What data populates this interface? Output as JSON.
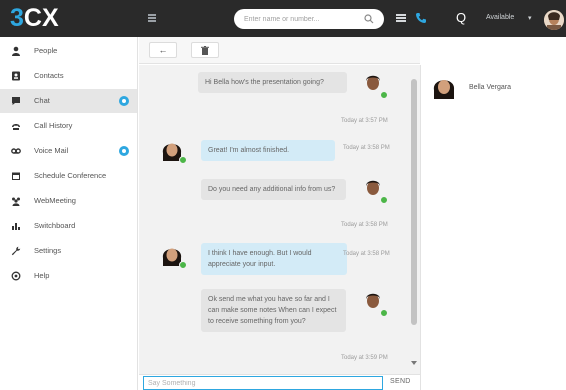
{
  "header": {
    "logo_prefix": "3",
    "logo_suffix": "CX",
    "search_placeholder": "Enter name or number...",
    "q_label": "Q",
    "status_label": "Available",
    "status_caret": "▾"
  },
  "sidebar": {
    "items": [
      {
        "label": "People",
        "icon": "person-icon",
        "active": false
      },
      {
        "label": "Contacts",
        "icon": "contacts-icon",
        "active": false
      },
      {
        "label": "Chat",
        "icon": "chat-icon",
        "active": true,
        "badge": true
      },
      {
        "label": "Call History",
        "icon": "call-history-icon",
        "active": false
      },
      {
        "label": "Voice Mail",
        "icon": "voicemail-icon",
        "active": false,
        "badge": true
      },
      {
        "label": "Schedule Conference",
        "icon": "calendar-icon",
        "active": false
      },
      {
        "label": "WebMeeting",
        "icon": "webmeeting-icon",
        "active": false
      },
      {
        "label": "Switchboard",
        "icon": "switchboard-icon",
        "active": false
      },
      {
        "label": "Settings",
        "icon": "wrench-icon",
        "active": false
      },
      {
        "label": "Help",
        "icon": "help-icon",
        "active": false
      }
    ]
  },
  "toolbar": {
    "back_label": "←",
    "delete_label": "🗑"
  },
  "chat": {
    "messages": [
      {
        "text": "Hi Bella how's the presentation going?",
        "direction": "out",
        "timestamp": "Today at 3:57 PM"
      },
      {
        "text": "Great! I'm almost finished.",
        "direction": "in",
        "timestamp": "Today at 3:58 PM"
      },
      {
        "text": "Do you need any additional info from us?",
        "direction": "out",
        "timestamp": "Today at 3:58 PM"
      },
      {
        "text": "I think I have enough. But I would appreciate your input.",
        "direction": "in",
        "timestamp": "Today at 3:58 PM"
      },
      {
        "text": "Ok send me what you have so far and I can make some notes When can I expect to receive something from you?",
        "direction": "out",
        "timestamp": "Today at 3:59 PM"
      }
    ],
    "compose_placeholder": "Say Something",
    "send_label": "SEND"
  },
  "participants": [
    {
      "name": "Bella Vergara"
    }
  ],
  "colors": {
    "accent": "#2ea7e0",
    "topbar": "#2a2a2a",
    "online": "#4cb648",
    "bubble_out": "#e4e4e4",
    "bubble_in": "#d3ebf7"
  }
}
